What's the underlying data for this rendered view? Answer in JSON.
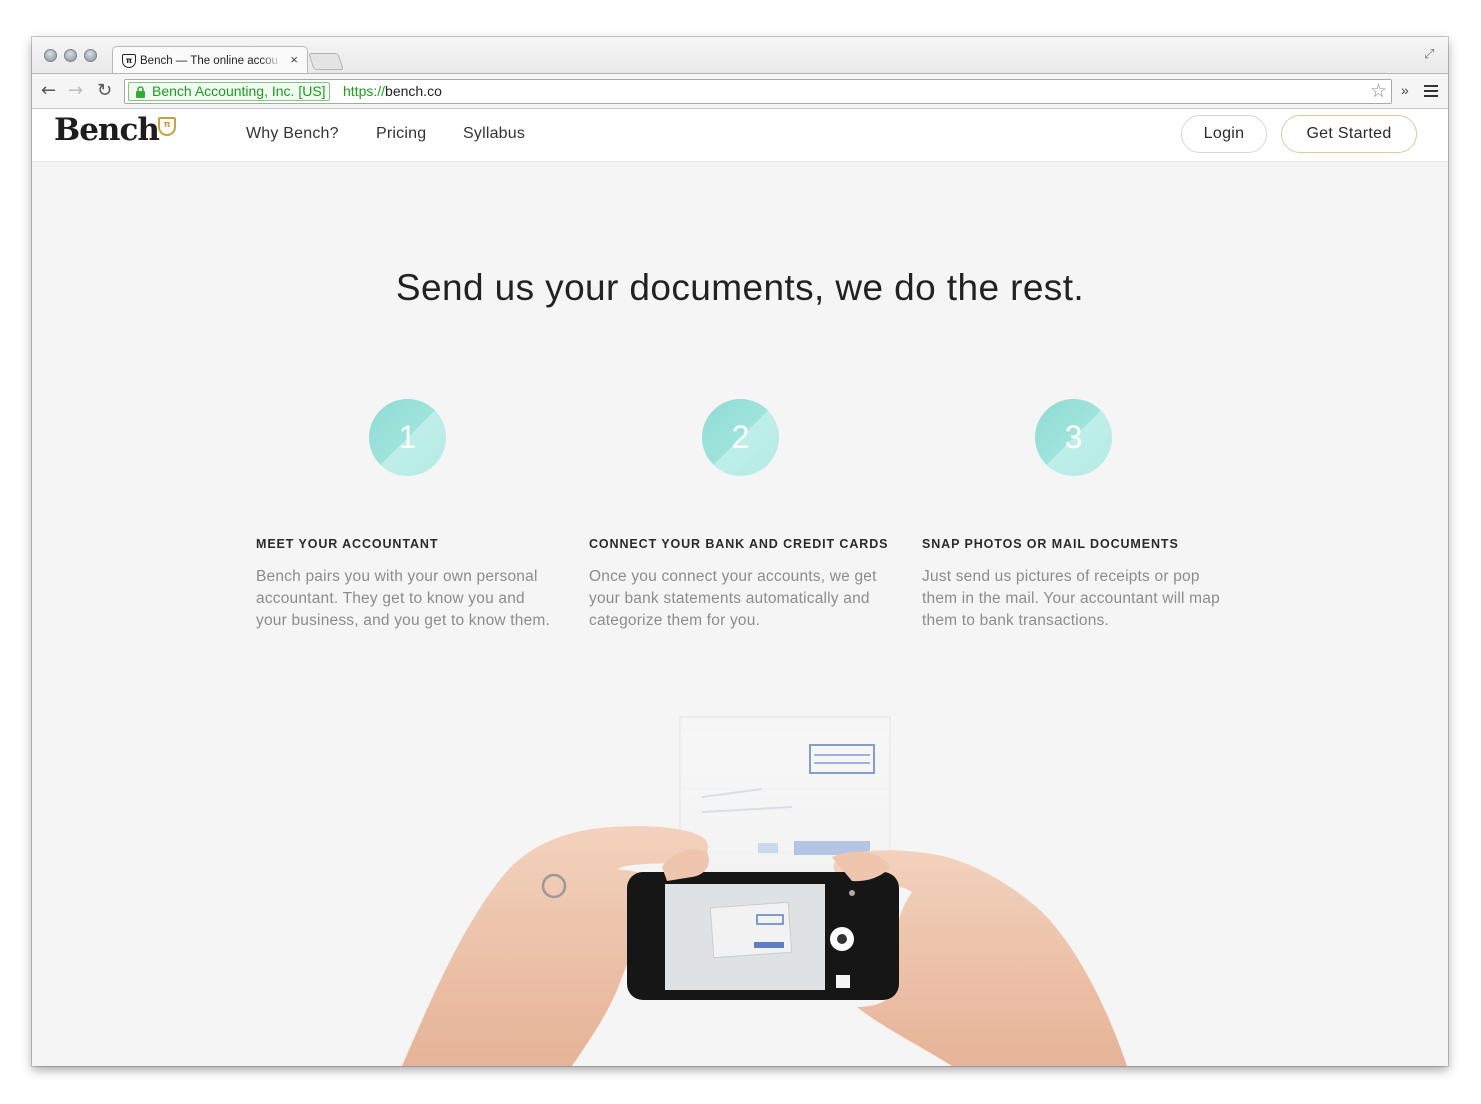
{
  "browser": {
    "tab_title": "Bench — The online accou",
    "tab_close": "×",
    "ev_label": "Bench Accounting, Inc. [US]",
    "url_scheme": "https://",
    "url_host": "bench.co",
    "overflow": "»"
  },
  "header": {
    "logo": "Bench",
    "nav": [
      "Why Bench?",
      "Pricing",
      "Syllabus"
    ],
    "login_label": "Login",
    "get_started_label": "Get Started",
    "accent_color": "#c9a23e"
  },
  "main": {
    "headline": "Send us your documents, we do the rest.",
    "steps": [
      {
        "number": "1",
        "title": "MEET YOUR ACCOUNTANT",
        "text": "Bench pairs you with your own personal accountant. They get to know you and your business, and you get to know them."
      },
      {
        "number": "2",
        "title": "CONNECT YOUR BANK AND CREDIT CARDS",
        "text": "Once you connect your accounts, we get your bank statements automatically and categorize them for you."
      },
      {
        "number": "3",
        "title": "SNAP PHOTOS OR MAIL DOCUMENTS",
        "text": "Just send us pictures of receipts or pop them in the mail. Your accountant will map them to bank transactions."
      }
    ],
    "circle_color": "#9fe3dc"
  }
}
